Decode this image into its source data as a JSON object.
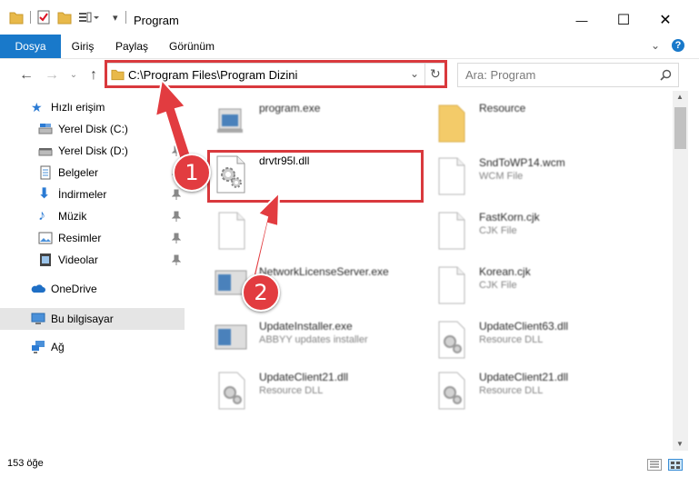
{
  "window": {
    "title": "Program",
    "minimize_glyph": "—",
    "maximize_glyph": "☐",
    "close_glyph": "✕"
  },
  "ribbon": {
    "tabs": [
      {
        "label": "Dosya",
        "active": true
      },
      {
        "label": "Giriş",
        "active": false
      },
      {
        "label": "Paylaş",
        "active": false
      },
      {
        "label": "Görünüm",
        "active": false
      }
    ],
    "help_glyph": "?"
  },
  "address_bar": {
    "path": "C:\\Program Files\\Program Dizini"
  },
  "search": {
    "placeholder": "Ara: Program"
  },
  "sidebar": {
    "items": [
      {
        "label": "Hızlı erişim",
        "icon": "star-icon",
        "pinned": false
      },
      {
        "label": "Yerel Disk (C:)",
        "icon": "drive-icon",
        "pinned": true
      },
      {
        "label": "Yerel Disk (D:)",
        "icon": "drive-icon",
        "pinned": true
      },
      {
        "label": "Belgeler",
        "icon": "documents-icon",
        "pinned": true
      },
      {
        "label": "İndirmeler",
        "icon": "download-icon",
        "pinned": true
      },
      {
        "label": "Müzik",
        "icon": "music-icon",
        "pinned": true
      },
      {
        "label": "Resimler",
        "icon": "pictures-icon",
        "pinned": true
      },
      {
        "label": "Videolar",
        "icon": "video-icon",
        "pinned": true
      },
      {
        "label": "OneDrive",
        "icon": "cloud-icon",
        "pinned": false
      },
      {
        "label": "Bu bilgisayar",
        "icon": "computer-icon",
        "pinned": false
      },
      {
        "label": "Ağ",
        "icon": "network-icon",
        "pinned": false
      }
    ]
  },
  "files": [
    {
      "name": "program.exe",
      "type": "",
      "icon": "exe-icon"
    },
    {
      "name": "Resource",
      "type": "",
      "icon": "folder-icon"
    },
    {
      "name": "drvtr95l.dll",
      "type": "",
      "icon": "dll-icon"
    },
    {
      "name": "SndToWP14.wcm",
      "type": "WCM File",
      "icon": "file-icon"
    },
    {
      "name": "",
      "type": "",
      "icon": "file-icon"
    },
    {
      "name": "FastKorn.cjk",
      "type": "CJK File",
      "icon": "file-icon"
    },
    {
      "name": "NetworkLicenseServer.exe",
      "type": "",
      "icon": "exe-icon"
    },
    {
      "name": "Korean.cjk",
      "type": "CJK File",
      "icon": "file-icon"
    },
    {
      "name": "UpdateInstaller.exe",
      "type": "ABBYY updates installer",
      "icon": "exe-icon"
    },
    {
      "name": "UpdateClient63.dll",
      "type": "Resource DLL",
      "icon": "dll-icon"
    },
    {
      "name": "UpdateClient21.dll",
      "type": "Resource DLL",
      "icon": "dll-icon"
    },
    {
      "name": "UpdateClient21.dll",
      "type": "Resource DLL",
      "icon": "dll-icon"
    }
  ],
  "status": {
    "count": "153 öğe"
  },
  "annotations": [
    {
      "number": "1"
    },
    {
      "number": "2"
    }
  ],
  "colors": {
    "accent": "#1979ca",
    "annotation_red": "#d9393d"
  }
}
